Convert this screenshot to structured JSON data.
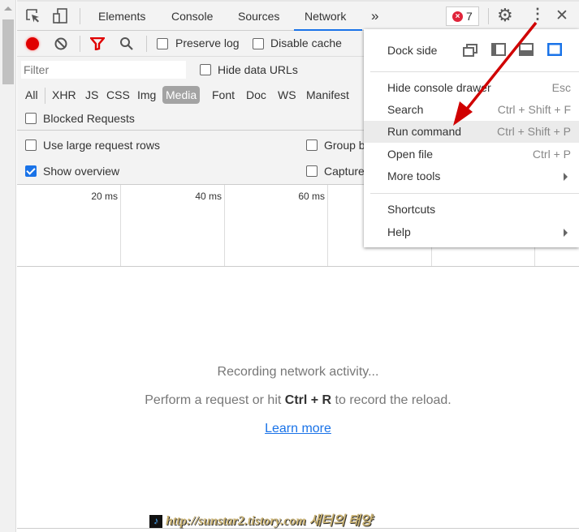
{
  "tabs": {
    "items": [
      "Elements",
      "Console",
      "Sources",
      "Network"
    ],
    "active": "Network",
    "more": "»",
    "error_count": "7"
  },
  "toolbar": {
    "preserve_log": "Preserve log",
    "disable_cache": "Disable cache",
    "preserve_checked": false,
    "disable_checked": false
  },
  "filter": {
    "placeholder": "Filter",
    "hide_data_urls": "Hide data URLs",
    "types": [
      "All",
      "XHR",
      "JS",
      "CSS",
      "Img",
      "Media",
      "Font",
      "Doc",
      "WS",
      "Manifest"
    ],
    "active_type": "Media",
    "blocked_requests": "Blocked Requests"
  },
  "options": {
    "large_rows": "Use large request rows",
    "show_overview": "Show overview",
    "group": "Group b",
    "capture": "Capture",
    "show_overview_checked": true
  },
  "timeline": {
    "ticks": [
      "20 ms",
      "40 ms",
      "60 ms"
    ]
  },
  "empty": {
    "recording": "Recording network activity...",
    "hint_pre": "Perform a request or hit ",
    "hint_key": "Ctrl + R",
    "hint_post": " to record the reload.",
    "learn_more": "Learn more"
  },
  "menu": {
    "dock_side": "Dock side",
    "active_dock": "right",
    "items": [
      {
        "label": "Hide console drawer",
        "shortcut": "Esc"
      },
      {
        "label": "Search",
        "shortcut": "Ctrl + Shift + F"
      },
      {
        "label": "Run command",
        "shortcut": "Ctrl + Shift + P",
        "highlighted": true
      },
      {
        "label": "Open file",
        "shortcut": "Ctrl + P"
      },
      {
        "label": "More tools",
        "shortcut": ""
      }
    ],
    "items2": [
      {
        "label": "Shortcuts"
      },
      {
        "label": "Help"
      }
    ]
  },
  "annotation": {
    "arrow_color": "#e00000"
  },
  "watermark": {
    "text": "http://sunstar2.tistory.com 새터의 태양"
  },
  "colors": {
    "accent": "#1a73e8",
    "record": "#e00000"
  }
}
